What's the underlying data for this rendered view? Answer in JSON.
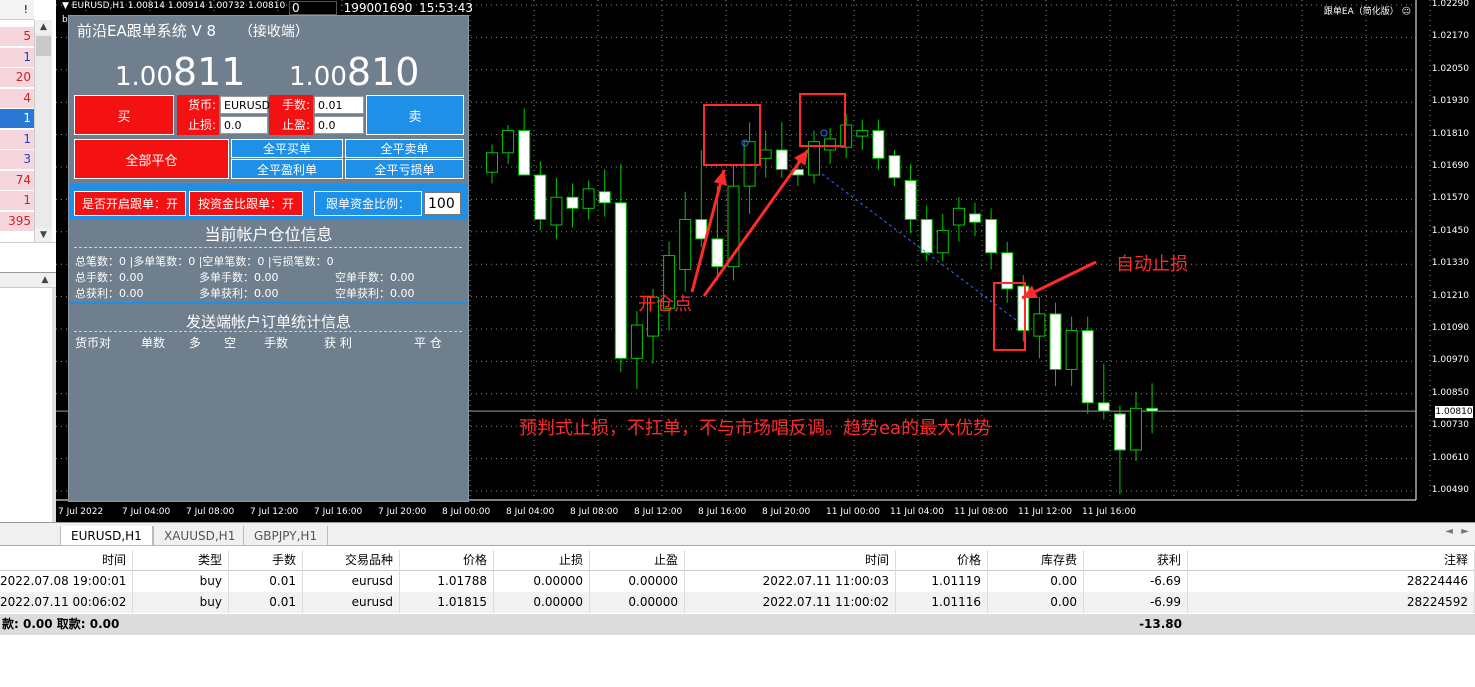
{
  "left_list": {
    "header": "!",
    "rows": [
      {
        "value": "5",
        "style": "r"
      },
      {
        "value": "1",
        "style": "b"
      },
      {
        "value": "20",
        "style": "r"
      },
      {
        "value": "4",
        "style": "r"
      },
      {
        "value": "1",
        "style": "sel"
      },
      {
        "value": "1",
        "style": "b"
      },
      {
        "value": "3",
        "style": "b"
      },
      {
        "value": "74",
        "style": "r"
      },
      {
        "value": "1",
        "style": "r"
      },
      {
        "value": "395",
        "style": "r"
      }
    ]
  },
  "chart": {
    "symbol_line": "EURUSD,H1  1.00814 1.00914 1.00732 1.00810",
    "sub_label": "bennikhhhh",
    "field_zero": "0",
    "field_id": "199001690",
    "field_time": "15:53:43",
    "ea_title": "跟单EA（简化版）",
    "current_price": "1.00810",
    "colors": {
      "background": "#000000",
      "bull": "#00c800",
      "bear": "#ffffff",
      "annotation": "#ff2b2b",
      "grid": "#8a8a8a"
    }
  },
  "panel": {
    "title": "前沿EA跟单系统 V 8",
    "title_suffix": "（接收端）",
    "bid_prefix": "1.00",
    "bid_suffix": "811",
    "ask_prefix": "1.00",
    "ask_suffix": "810",
    "buy_label": "买",
    "sell_label": "卖",
    "currency_label": "货币:",
    "currency_value": "EURUSD",
    "lots_label": "手数:",
    "lots_value": "0.01",
    "sl_label": "止损:",
    "sl_value": "0.0",
    "tp_label": "止盈:",
    "tp_value": "0.0",
    "close_all_label": "全部平仓",
    "close_buy_label": "全平买单",
    "close_sell_label": "全平卖单",
    "close_profit_label": "全平盈利单",
    "close_loss_label": "全平亏损单",
    "follow_toggle_label": "是否开启跟单：开",
    "ratio_toggle_label": "按资金比跟单：开",
    "ratio_label": "跟单资金比例：",
    "ratio_value": "100",
    "account_section_title": "当前帐户仓位信息",
    "stats_row1": "总笔数：0   |多单笔数：0   |空单笔数：0   |亏损笔数：0",
    "stats_row2_a": "总手数：0.00",
    "stats_row2_b": "多单手数：0.00",
    "stats_row2_c": "空单手数：0.00",
    "stats_row3_a": "总获利：0.00",
    "stats_row3_b": "多单获利：0.00",
    "stats_row3_c": "空单获利：0.00",
    "sender_section_title": "发送端帐户订单统计信息",
    "sender_headers": [
      "货币对",
      "单数",
      "多",
      "空",
      "手数",
      "获 利",
      "平 仓"
    ]
  },
  "annotations": {
    "open_point": "开仓点",
    "auto_stop": "自动止损",
    "slogan": "预判式止损，不扛单，不与市场唱反调。趋势ea的最大优势"
  },
  "y_axis": [
    "1.02290",
    "1.02170",
    "1.02050",
    "1.01930",
    "1.01810",
    "1.01690",
    "1.01570",
    "1.01450",
    "1.01330",
    "1.01210",
    "1.01090",
    "1.00970",
    "1.00850",
    "1.00730",
    "1.00610",
    "1.00490"
  ],
  "x_axis": [
    "7 Jul 2022",
    "7 Jul 04:00",
    "7 Jul 08:00",
    "7 Jul 12:00",
    "7 Jul 16:00",
    "7 Jul 20:00",
    "8 Jul 00:00",
    "8 Jul 04:00",
    "8 Jul 08:00",
    "8 Jul 12:00",
    "8 Jul 16:00",
    "8 Jul 20:00",
    "11 Jul 00:00",
    "11 Jul 04:00",
    "11 Jul 08:00",
    "11 Jul 12:00",
    "11 Jul 16:00"
  ],
  "tabs": [
    {
      "label": "EURUSD,H1",
      "active": true
    },
    {
      "label": "XAUUSD,H1",
      "active": false
    },
    {
      "label": "GBPJPY,H1",
      "active": false
    }
  ],
  "trade_table": {
    "headers": [
      "时间",
      "类型",
      "手数",
      "交易品种",
      "价格",
      "止损",
      "止盈",
      "时间",
      "价格",
      "库存费",
      "获利",
      "注释"
    ],
    "rows": [
      [
        "2022.07.08 19:00:01",
        "buy",
        "0.01",
        "eurusd",
        "1.01788",
        "0.00000",
        "0.00000",
        "2022.07.11 11:00:03",
        "1.01119",
        "0.00",
        "-6.69",
        "28224446"
      ],
      [
        "2022.07.11 00:06:02",
        "buy",
        "0.01",
        "eurusd",
        "1.01815",
        "0.00000",
        "0.00000",
        "2022.07.11 11:00:02",
        "1.01116",
        "0.00",
        "-6.99",
        "28224592"
      ]
    ],
    "total_left": "款: 0.00  取款: 0.00",
    "total_profit": "-13.80"
  },
  "chart_data": {
    "type": "candlestick",
    "timeframe": "H1",
    "ylim": [
      1.0049,
      1.0229
    ],
    "candles": [
      {
        "o": 1.0167,
        "h": 1.0177,
        "l": 1.0163,
        "c": 1.0174
      },
      {
        "o": 1.0174,
        "h": 1.0184,
        "l": 1.017,
        "c": 1.0182
      },
      {
        "o": 1.0182,
        "h": 1.019,
        "l": 1.017,
        "c": 1.0166
      },
      {
        "o": 1.0166,
        "h": 1.0171,
        "l": 1.0146,
        "c": 1.015
      },
      {
        "o": 1.0148,
        "h": 1.0165,
        "l": 1.0143,
        "c": 1.0158
      },
      {
        "o": 1.0158,
        "h": 1.0163,
        "l": 1.0147,
        "c": 1.0154
      },
      {
        "o": 1.0154,
        "h": 1.0164,
        "l": 1.015,
        "c": 1.0161
      },
      {
        "o": 1.016,
        "h": 1.0168,
        "l": 1.0151,
        "c": 1.0156
      },
      {
        "o": 1.0156,
        "h": 1.017,
        "l": 1.0095,
        "c": 1.01
      },
      {
        "o": 1.01,
        "h": 1.0117,
        "l": 1.0089,
        "c": 1.0112
      },
      {
        "o": 1.0108,
        "h": 1.0125,
        "l": 1.0098,
        "c": 1.0122
      },
      {
        "o": 1.0118,
        "h": 1.0142,
        "l": 1.011,
        "c": 1.0137
      },
      {
        "o": 1.0132,
        "h": 1.016,
        "l": 1.0124,
        "c": 1.015
      },
      {
        "o": 1.015,
        "h": 1.0175,
        "l": 1.014,
        "c": 1.0143
      },
      {
        "o": 1.0143,
        "h": 1.0162,
        "l": 1.0128,
        "c": 1.0133
      },
      {
        "o": 1.0133,
        "h": 1.017,
        "l": 1.0128,
        "c": 1.0162
      },
      {
        "o": 1.0162,
        "h": 1.0185,
        "l": 1.0152,
        "c": 1.0178
      },
      {
        "o": 1.0172,
        "h": 1.0182,
        "l": 1.0165,
        "c": 1.0175
      },
      {
        "o": 1.0175,
        "h": 1.0185,
        "l": 1.0165,
        "c": 1.0168
      },
      {
        "o": 1.0168,
        "h": 1.0172,
        "l": 1.0162,
        "c": 1.0166
      },
      {
        "o": 1.0166,
        "h": 1.0182,
        "l": 1.0163,
        "c": 1.0178
      },
      {
        "o": 1.0175,
        "h": 1.0183,
        "l": 1.017,
        "c": 1.0179
      },
      {
        "o": 1.0176,
        "h": 1.0188,
        "l": 1.0172,
        "c": 1.0184
      },
      {
        "o": 1.018,
        "h": 1.0186,
        "l": 1.0175,
        "c": 1.0182
      },
      {
        "o": 1.0182,
        "h": 1.0186,
        "l": 1.0168,
        "c": 1.0172
      },
      {
        "o": 1.0173,
        "h": 1.0175,
        "l": 1.0162,
        "c": 1.0165
      },
      {
        "o": 1.0164,
        "h": 1.017,
        "l": 1.0145,
        "c": 1.015
      },
      {
        "o": 1.015,
        "h": 1.0155,
        "l": 1.0135,
        "c": 1.0138
      },
      {
        "o": 1.0138,
        "h": 1.0152,
        "l": 1.0135,
        "c": 1.0146
      },
      {
        "o": 1.0148,
        "h": 1.0158,
        "l": 1.0142,
        "c": 1.0154
      },
      {
        "o": 1.0152,
        "h": 1.0156,
        "l": 1.0144,
        "c": 1.0149
      },
      {
        "o": 1.015,
        "h": 1.0154,
        "l": 1.0132,
        "c": 1.0138
      },
      {
        "o": 1.0138,
        "h": 1.0142,
        "l": 1.012,
        "c": 1.0125
      },
      {
        "o": 1.0126,
        "h": 1.013,
        "l": 1.0106,
        "c": 1.011
      },
      {
        "o": 1.0108,
        "h": 1.0122,
        "l": 1.01,
        "c": 1.0116
      },
      {
        "o": 1.0116,
        "h": 1.012,
        "l": 1.009,
        "c": 1.0096
      },
      {
        "o": 1.0096,
        "h": 1.0115,
        "l": 1.009,
        "c": 1.011
      },
      {
        "o": 1.011,
        "h": 1.0115,
        "l": 1.008,
        "c": 1.0084
      },
      {
        "o": 1.0084,
        "h": 1.0098,
        "l": 1.0078,
        "c": 1.0081
      },
      {
        "o": 1.008,
        "h": 1.0083,
        "l": 1.0051,
        "c": 1.0067
      },
      {
        "o": 1.0067,
        "h": 1.0088,
        "l": 1.0063,
        "c": 1.0082
      },
      {
        "o": 1.0082,
        "h": 1.0091,
        "l": 1.0073,
        "c": 1.0081
      }
    ]
  }
}
